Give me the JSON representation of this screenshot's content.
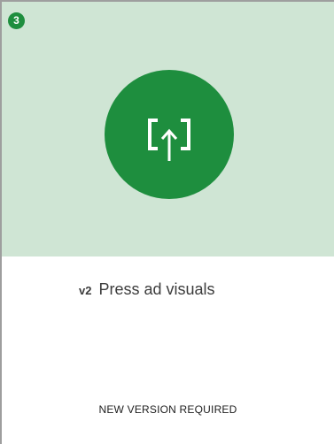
{
  "card": {
    "badge_number": "3",
    "icon": "upload-frame-icon",
    "version_label": "v2",
    "title": "Press ad visuals",
    "status_text": "NEW VERSION REQUIRED"
  },
  "colors": {
    "accent_green": "#1e8e3e",
    "preview_background": "#cfe5d4",
    "border_gray": "#9e9e9e"
  }
}
